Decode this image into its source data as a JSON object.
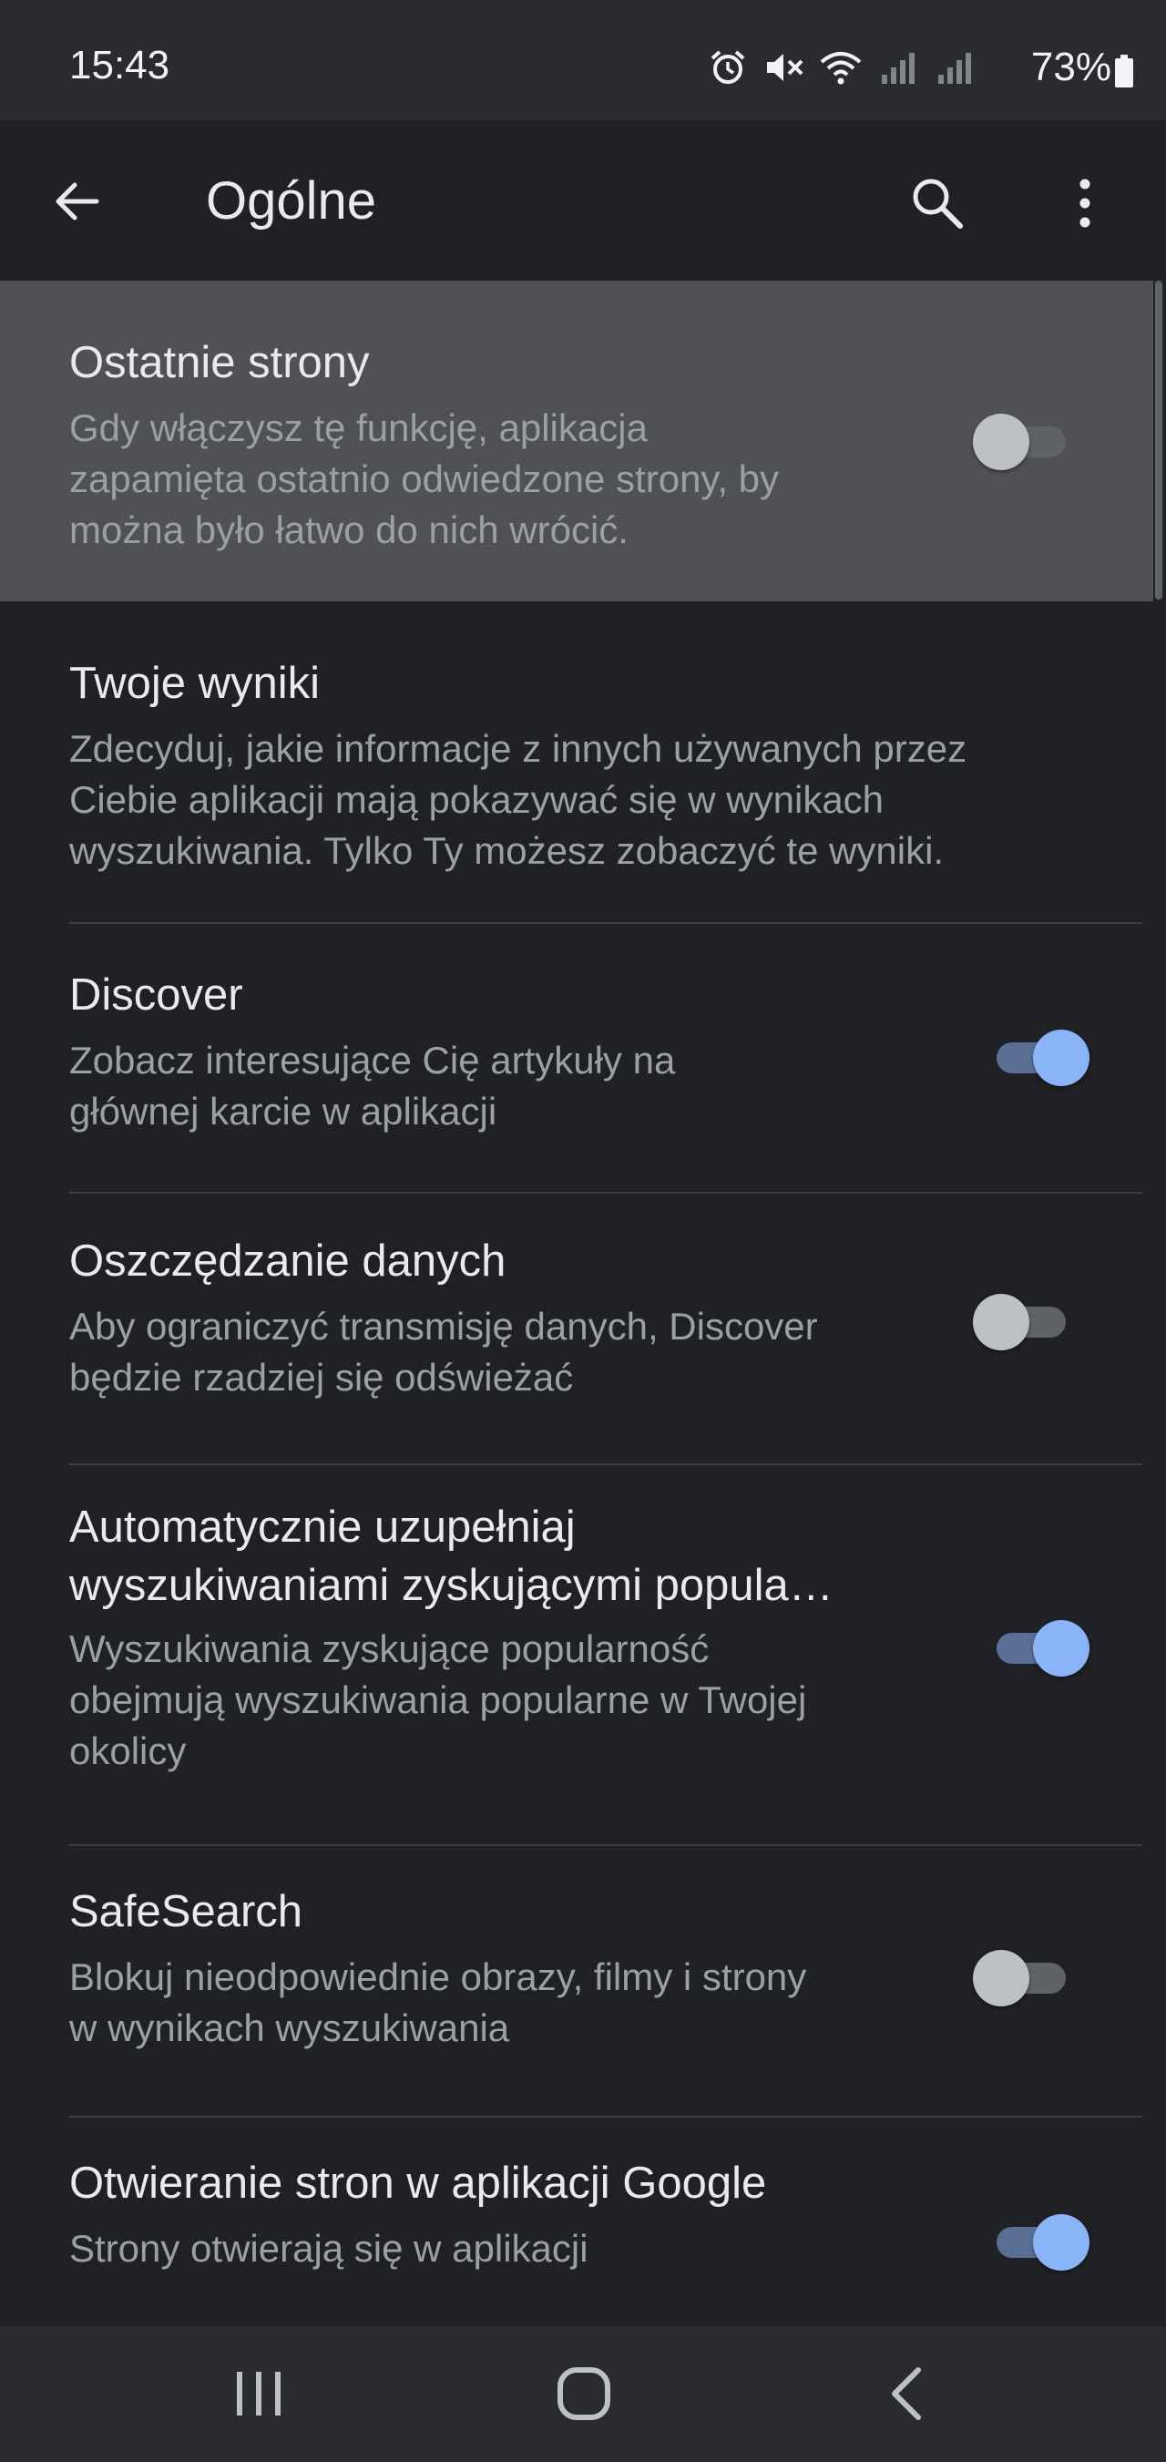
{
  "status_bar": {
    "time": "15:43",
    "battery_percent": "73%",
    "icons": [
      "alarm-icon",
      "mute-icon",
      "wifi-icon",
      "signal-icon",
      "signal-icon",
      "battery-icon"
    ]
  },
  "app_bar": {
    "title": "Ogólne",
    "icons": [
      "arrow-back-icon",
      "search-icon",
      "more-vert-icon"
    ]
  },
  "settings": [
    {
      "title": "Ostatnie strony",
      "description": "Gdy włączysz tę funkcję, aplikacja\nzapamięta ostatnio odwiedzone strony, by\nmożna było łatwo do nich wrócić.",
      "toggle": "off",
      "highlighted": true
    },
    {
      "title": "Twoje wyniki",
      "description": "Zdecyduj, jakie informacje z innych używanych przez\nCiebie aplikacji mają pokazywać się w wynikach\nwyszukiwania. Tylko Ty możesz zobaczyć te wyniki."
    },
    {
      "title": "Discover",
      "description": "Zobacz interesujące Cię artykuły na\ngłównej karcie w aplikacji",
      "toggle": "on"
    },
    {
      "title": "Oszczędzanie danych",
      "description": "Aby ograniczyć transmisję danych, Discover\nbędzie rzadziej się odświeżać",
      "toggle": "off"
    },
    {
      "title": "Automatycznie uzupełniaj\nwyszukiwaniami zyskującymi popula…",
      "description": "Wyszukiwania zyskujące popularność\nobejmują wyszukiwania popularne w Twojej\nokolicy",
      "toggle": "on"
    },
    {
      "title": "SafeSearch",
      "description": "Blokuj nieodpowiednie obrazy, filmy i strony\nw wynikach wyszukiwania",
      "toggle": "off"
    },
    {
      "title": "Otwieranie stron w aplikacji Google",
      "description": "Strony otwierają się w aplikacji",
      "toggle": "on"
    }
  ],
  "nav_bar": {
    "icons": [
      "recent-apps-icon",
      "home-icon",
      "back-icon"
    ]
  },
  "colors": {
    "background": "#202124",
    "highlight": "#505154",
    "accent": "#8ab4f8",
    "secondary_text": "#9aa0a6"
  }
}
